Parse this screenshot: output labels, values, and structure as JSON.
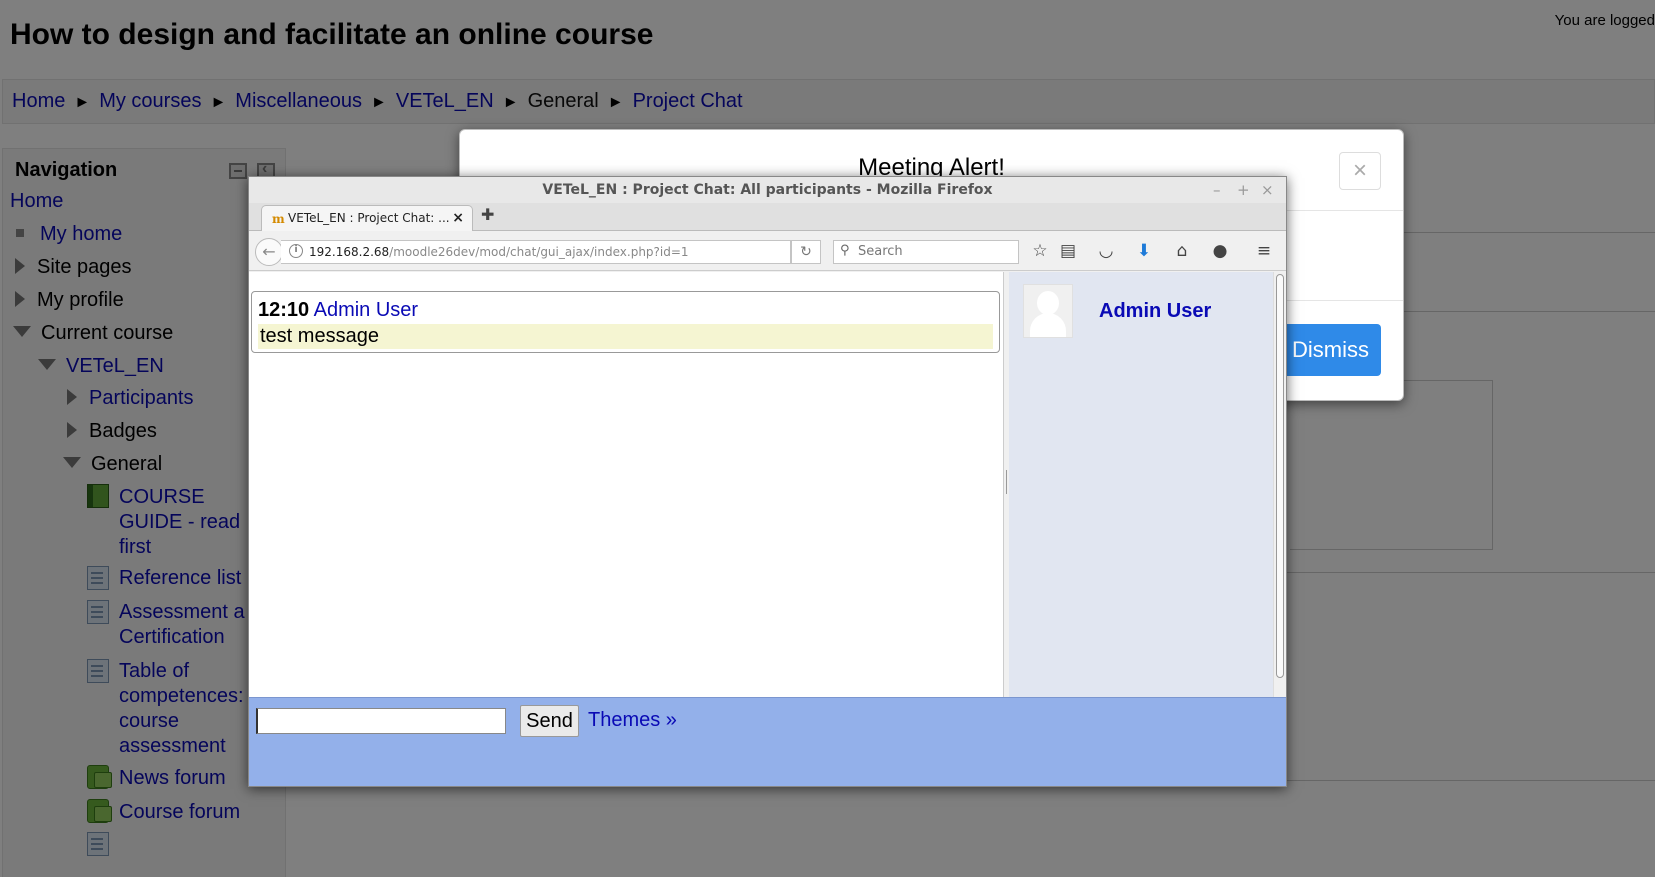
{
  "page": {
    "title": "How to design and facilitate an online course",
    "logged_in_text": "You are logged"
  },
  "breadcrumb": {
    "items": [
      {
        "label": "Home",
        "link": true
      },
      {
        "label": "My courses",
        "link": true
      },
      {
        "label": "Miscellaneous",
        "link": true
      },
      {
        "label": "VETeL_EN",
        "link": true
      },
      {
        "label": "General",
        "link": false
      },
      {
        "label": "Project Chat",
        "link": true
      }
    ],
    "separator": "►"
  },
  "navigation": {
    "title": "Navigation",
    "home": "Home",
    "my_home": "My home",
    "site_pages": "Site pages",
    "my_profile": "My profile",
    "current_course": "Current course",
    "course": "VETeL_EN",
    "participants": "Participants",
    "badges": "Badges",
    "general": "General",
    "activities": [
      {
        "lines": [
          "COURSE",
          "GUIDE - read",
          "first"
        ],
        "icon": "book-icon"
      },
      {
        "lines": [
          "Reference list"
        ],
        "icon": "page-icon"
      },
      {
        "lines": [
          "Assessment a",
          "Certification"
        ],
        "icon": "page-icon"
      },
      {
        "lines": [
          "Table of",
          "competences:",
          "course",
          "assessment"
        ],
        "icon": "page-icon"
      },
      {
        "lines": [
          "News forum"
        ],
        "icon": "forum-icon"
      },
      {
        "lines": [
          "Course forum"
        ],
        "icon": "forum-icon"
      }
    ]
  },
  "modal": {
    "title": "Meeting Alert!",
    "close_glyph": "×",
    "dismiss_label": "Dismiss"
  },
  "firefox": {
    "window_title": "VETeL_EN : Project Chat: All participants - Mozilla Firefox",
    "window_controls": [
      "–",
      "+",
      "×"
    ],
    "tab_label": "VETeL_EN : Project Chat: ...",
    "tab_favicon": "m",
    "url_host": "192.168.2.68",
    "url_path": "/moodle26dev/mod/chat/gui_ajax/index.php?id=1",
    "search_placeholder": "Search",
    "toolbar_icons": [
      "bookmark-star-icon",
      "reading-list-icon",
      "pocket-icon",
      "download-icon",
      "home-icon",
      "chat-bubble-icon",
      "menu-icon"
    ]
  },
  "chat": {
    "messages": [
      {
        "time": "12:10",
        "user": "Admin User",
        "text": "test message"
      }
    ],
    "users": [
      "Admin User"
    ],
    "input_value": "",
    "send_label": "Send",
    "themes_label": "Themes »"
  },
  "colors": {
    "link": "#0a0ab5",
    "dismiss_button": "#2f8ae8",
    "chat_input_bar": "#93b0ea",
    "user_pane": "#e1e6f1",
    "message_highlight": "#f5f5d2"
  }
}
